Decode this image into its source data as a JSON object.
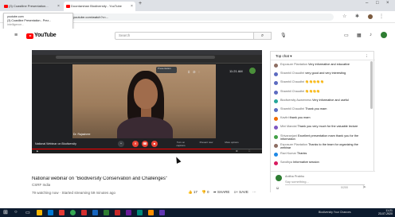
{
  "browser": {
    "tabs": [
      {
        "label": "(3) Coastline Presentation...",
        "active": false
      },
      {
        "label": "Doordarshan Biodiversity - YouTube",
        "active": true
      }
    ],
    "new_tab": "+",
    "address": "youtube.com/watch?v=...",
    "tooltip_lines": [
      "youtube.com",
      "(3) Coastline Presentation - Prez...",
      "Intelligence..."
    ]
  },
  "masthead": {
    "logo": "YouTube",
    "search_placeholder": "Search"
  },
  "player": {
    "meeting_banner": "Presentation",
    "meeting_time": "11:21 AM",
    "presenter_label": "Dr. Rajashree",
    "bottom_title": "National Webinar on Biodiversity",
    "controls_labels": [
      "Turn on captions",
      "Present now",
      "More options"
    ]
  },
  "video": {
    "title": "National webinar on \"Biodiversity Conservation and Challenges\"",
    "channel": "CSRF India",
    "meta": "79 watching now · Started streaming 59 minutes ago",
    "likes": "17",
    "dislikes": "0",
    "share_label": "SHARE",
    "save_label": "SAVE"
  },
  "chat": {
    "header": "Top chat",
    "messages": [
      {
        "author": "Exposure Plantation",
        "text": "Very informative and educative",
        "color": "#8d6e63"
      },
      {
        "author": "Shamhil Chaudhri",
        "text": "very good and very interesting",
        "color": "#5c6bc0"
      },
      {
        "author": "Shamhil Chaudhri",
        "text": "👏👏👏👏👏",
        "color": "#5c6bc0"
      },
      {
        "author": "Shamhil Chaudhri",
        "text": "👏👏👏👏",
        "color": "#5c6bc0"
      },
      {
        "author": "Biodiversity Awareness",
        "text": "Very informative and useful",
        "color": "#26a69a"
      },
      {
        "author": "Shamhil Chaudhri",
        "text": "Thank you mam",
        "color": "#5c6bc0"
      },
      {
        "author": "Kavitri",
        "text": "thank you mam",
        "color": "#ef6c00"
      },
      {
        "author": "Mini Mandal",
        "text": "Thank you very much for the valuable lecture",
        "color": "#7e57c2"
      },
      {
        "author": "Shivaranjani",
        "text": "Excellent presentation mam thank you for the information",
        "color": "#43a047"
      },
      {
        "author": "Exposure Plantation",
        "text": "Thanks to the team for organizing the webinar",
        "color": "#8d6e63"
      },
      {
        "author": "Ravi Kumar",
        "text": "Thanks",
        "color": "#1e88e5"
      },
      {
        "author": "Sandhya",
        "text": "Informative session",
        "color": "#d81b60"
      }
    ],
    "user_name": "Anitha Prabhu",
    "input_placeholder": "Say something...",
    "char_counter": "0/200",
    "send_icon": "➤"
  },
  "taskbar": {
    "tray_text": "Biodiversity Your Chances",
    "clock_time": "11:21",
    "clock_date": "23-07-2020"
  }
}
